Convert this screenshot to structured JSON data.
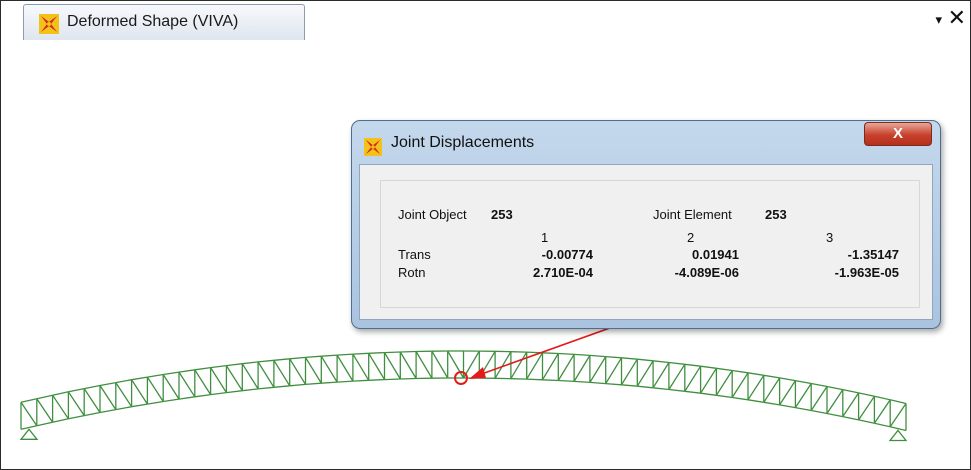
{
  "tab": {
    "title": "Deformed Shape (VIVA)",
    "menu_glyph": "▾",
    "close_glyph": "✕"
  },
  "dialog": {
    "title": "Joint Displacements",
    "close_glyph": "X",
    "joint_object_label": "Joint Object",
    "joint_object_value": "253",
    "joint_element_label": "Joint Element",
    "joint_element_value": "253",
    "columns": [
      "1",
      "2",
      "3"
    ],
    "rows": [
      {
        "label": "Trans",
        "values": [
          "-0.00774",
          "0.01941",
          "-1.35147"
        ]
      },
      {
        "label": "Rotn",
        "values": [
          "2.710E-04",
          "-4.089E-06",
          "-1.963E-05"
        ]
      }
    ]
  },
  "colors": {
    "truss": "#3f8f3f",
    "arrow": "#e21b1b",
    "dialog_frame": "#b3cbe4"
  },
  "icons": [
    "sap-logo-icon",
    "dropdown-arrow-icon",
    "close-icon"
  ]
}
